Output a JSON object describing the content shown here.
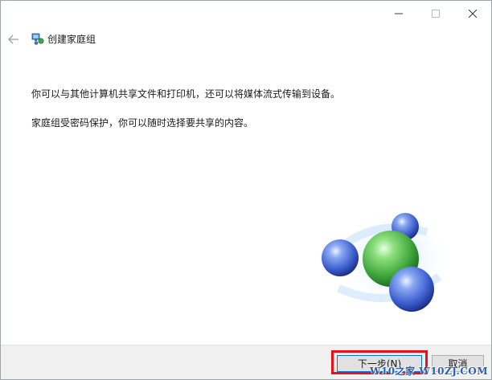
{
  "window": {
    "title": "创建家庭组",
    "controls": {
      "minimize_icon": "minimize-icon",
      "maximize_icon": "maximize-icon",
      "close_icon": "close-icon"
    }
  },
  "nav": {
    "back_icon": "back-arrow-icon",
    "wizard_icon": "homegroup-icon"
  },
  "content": {
    "paragraph_1": "你可以与其他计算机共享文件和打印机，还可以将媒体流式传输到设备。",
    "paragraph_2": "家庭组受密码保护，你可以随时选择要共享的内容。",
    "illustration": "homegroup-molecule-illustration"
  },
  "footer": {
    "next_label": "下一步(N)",
    "cancel_label": "取消"
  },
  "watermark": {
    "text": "W10之家 W10ZJ.COM"
  },
  "colors": {
    "highlight_box": "#e8101a",
    "accent": "#0078d7",
    "footer_bg": "#f0f0f0"
  }
}
